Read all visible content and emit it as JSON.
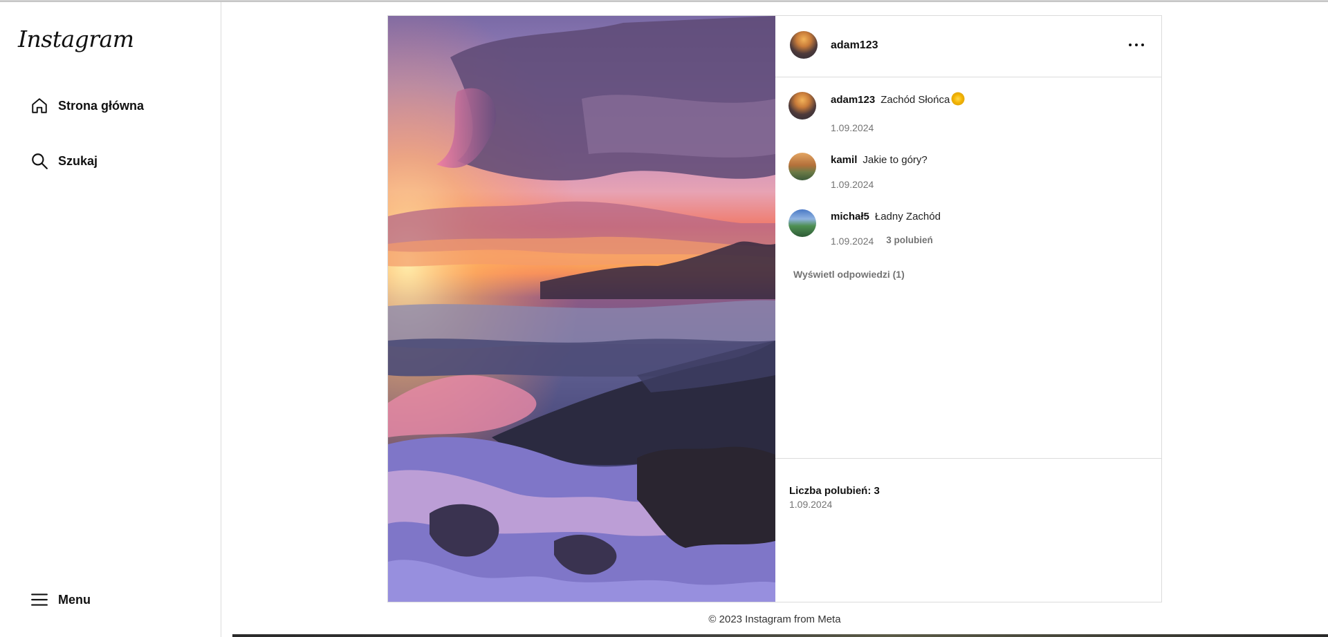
{
  "app": {
    "logo_text": "Instagram"
  },
  "sidebar": {
    "items": [
      {
        "label": "Strona główna",
        "icon": "home-icon"
      },
      {
        "label": "Szukaj",
        "icon": "search-icon"
      }
    ],
    "menu_label": "Menu"
  },
  "post": {
    "author": "adam123",
    "more_icon": "more-horizontal-icon",
    "comments": [
      {
        "user": "adam123",
        "text": "Zachód Słońca",
        "emoji": "sun",
        "date": "1.09.2024"
      },
      {
        "user": "kamil",
        "text": "Jakie to góry?",
        "date": "1.09.2024"
      },
      {
        "user": "michał5",
        "text": "Ładny Zachód",
        "date": "1.09.2024",
        "likes": "3 polubień"
      }
    ],
    "view_replies": "Wyświetl odpowiedzi (1)",
    "likes_summary": "Liczba polubień: 3",
    "date": "1.09.2024"
  },
  "footer": {
    "text": "© 2023 Instagram from Meta"
  },
  "colors": {
    "border": "#dbdbdb",
    "muted": "#737373"
  }
}
